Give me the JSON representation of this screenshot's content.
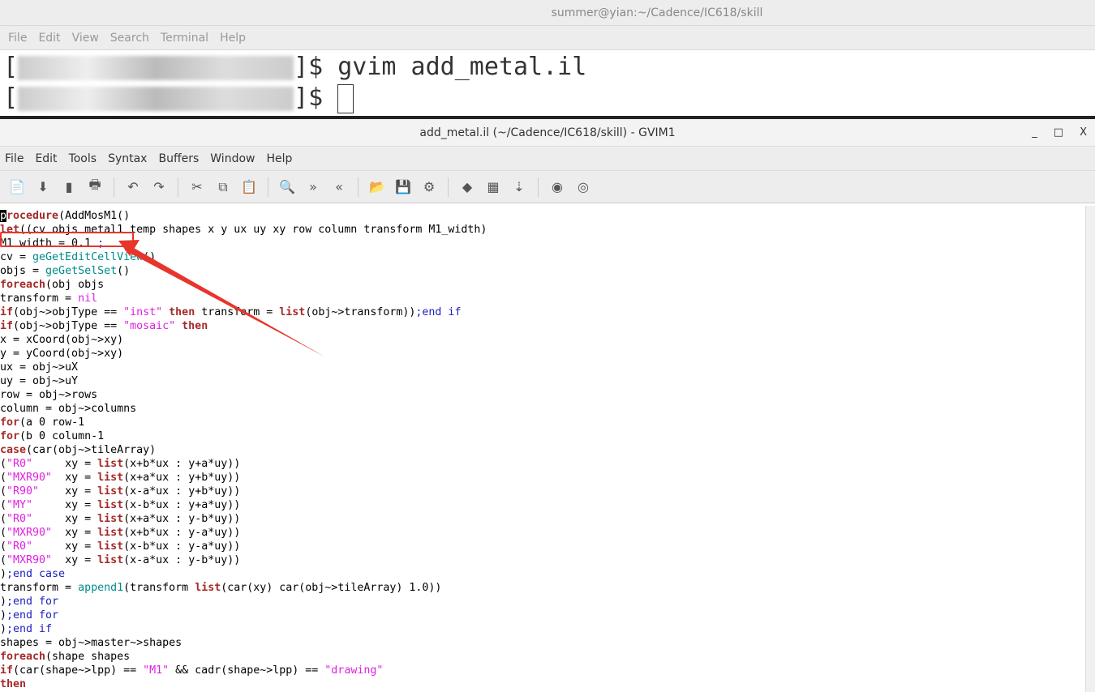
{
  "terminal": {
    "title": "summer@yian:~/Cadence/IC618/skill",
    "menu": [
      "File",
      "Edit",
      "View",
      "Search",
      "Terminal",
      "Help"
    ],
    "prompt_suffix": "]$ ",
    "command": "gvim add_metal.il",
    "prompt2_suffix": "]$ "
  },
  "gvim": {
    "title": "add_metal.il (~/Cadence/IC618/skill) - GVIM1",
    "controls": [
      "_",
      "□",
      "X"
    ],
    "menu": [
      "File",
      "Edit",
      "Tools",
      "Syntax",
      "Buffers",
      "Window",
      "Help"
    ],
    "toolbar": [
      {
        "name": "open",
        "g": "📄"
      },
      {
        "name": "save",
        "g": "⬇"
      },
      {
        "name": "save-all",
        "g": "▮"
      },
      {
        "name": "print",
        "g": "🖶"
      },
      "sep",
      {
        "name": "undo",
        "g": "↶"
      },
      {
        "name": "redo",
        "g": "↷"
      },
      "sep",
      {
        "name": "cut",
        "g": "✂"
      },
      {
        "name": "copy",
        "g": "⧉"
      },
      {
        "name": "paste",
        "g": "📋"
      },
      "sep",
      {
        "name": "find-replace",
        "g": "🔍"
      },
      {
        "name": "find-next",
        "g": "»"
      },
      {
        "name": "find-prev",
        "g": "«"
      },
      "sep",
      {
        "name": "load-session",
        "g": "📂"
      },
      {
        "name": "save-session",
        "g": "💾"
      },
      {
        "name": "run-script",
        "g": "⚙"
      },
      "sep",
      {
        "name": "make",
        "g": "◆"
      },
      {
        "name": "shell",
        "g": "▦"
      },
      {
        "name": "tags",
        "g": "⇣"
      },
      "sep",
      {
        "name": "help",
        "g": "◉"
      },
      {
        "name": "find-help",
        "g": "◎"
      }
    ]
  },
  "code": [
    [
      [
        "p",
        "cur"
      ],
      [
        "rocedure",
        "k"
      ],
      [
        "(AddMosM1()",
        ""
      ]
    ],
    [
      [
        "let",
        "k"
      ],
      [
        "((cv objs metal1 temp shapes x y ux uy xy row column transform M1_width)",
        ""
      ]
    ],
    [
      [
        "M1 width = 0.1 ",
        ""
      ],
      [
        ";",
        "b"
      ]
    ],
    [
      [
        "cv = ",
        ""
      ],
      [
        "geGetEditCellView",
        "f"
      ],
      [
        "()",
        ""
      ]
    ],
    [
      [
        "objs = ",
        ""
      ],
      [
        "geGetSelSet",
        "f"
      ],
      [
        "()",
        ""
      ]
    ],
    [
      [
        "foreach",
        "k"
      ],
      [
        "(obj objs",
        ""
      ]
    ],
    [
      [
        "transform = ",
        ""
      ],
      [
        "nil",
        "s"
      ]
    ],
    [
      [
        "if",
        "k"
      ],
      [
        "(obj~>objType == ",
        ""
      ],
      [
        "\"inst\"",
        "s"
      ],
      [
        " ",
        ""
      ],
      [
        "then",
        "k"
      ],
      [
        " transform = ",
        ""
      ],
      [
        "list",
        "k"
      ],
      [
        "(obj~>transform))",
        ""
      ],
      [
        ";end if",
        "b"
      ]
    ],
    [
      [
        "if",
        "k"
      ],
      [
        "(obj~>objType == ",
        ""
      ],
      [
        "\"mosaic\"",
        "s"
      ],
      [
        " ",
        ""
      ],
      [
        "then",
        "k"
      ]
    ],
    [
      [
        "x = xCoord(obj~>xy)",
        ""
      ]
    ],
    [
      [
        "y = yCoord(obj~>xy)",
        ""
      ]
    ],
    [
      [
        "ux = obj~>uX",
        ""
      ]
    ],
    [
      [
        "uy = obj~>uY",
        ""
      ]
    ],
    [
      [
        "row = obj~>rows",
        ""
      ]
    ],
    [
      [
        "column = obj~>columns",
        ""
      ]
    ],
    [
      [
        "for",
        "k"
      ],
      [
        "(a 0 row-1",
        ""
      ]
    ],
    [
      [
        "for",
        "k"
      ],
      [
        "(b 0 column-1",
        ""
      ]
    ],
    [
      [
        "case",
        "k"
      ],
      [
        "(car(obj~>tileArray)",
        ""
      ]
    ],
    [
      [
        "(",
        ""
      ],
      [
        "\"R0\"",
        "s"
      ],
      [
        "     xy = ",
        ""
      ],
      [
        "list",
        "k"
      ],
      [
        "(x+b*ux : y+a*uy))",
        ""
      ]
    ],
    [
      [
        "(",
        ""
      ],
      [
        "\"MXR90\"",
        "s"
      ],
      [
        "  xy = ",
        ""
      ],
      [
        "list",
        "k"
      ],
      [
        "(x+a*ux : y+b*uy))",
        ""
      ]
    ],
    [
      [
        "(",
        ""
      ],
      [
        "\"R90\"",
        "s"
      ],
      [
        "    xy = ",
        ""
      ],
      [
        "list",
        "k"
      ],
      [
        "(x-a*ux : y+b*uy))",
        ""
      ]
    ],
    [
      [
        "(",
        ""
      ],
      [
        "\"MY\"",
        "s"
      ],
      [
        "     xy = ",
        ""
      ],
      [
        "list",
        "k"
      ],
      [
        "(x-b*ux : y+a*uy))",
        ""
      ]
    ],
    [
      [
        "(",
        ""
      ],
      [
        "\"R0\"",
        "s"
      ],
      [
        "     xy = ",
        ""
      ],
      [
        "list",
        "k"
      ],
      [
        "(x+a*ux : y-b*uy))",
        ""
      ]
    ],
    [
      [
        "(",
        ""
      ],
      [
        "\"MXR90\"",
        "s"
      ],
      [
        "  xy = ",
        ""
      ],
      [
        "list",
        "k"
      ],
      [
        "(x+b*ux : y-a*uy))",
        ""
      ]
    ],
    [
      [
        "(",
        ""
      ],
      [
        "\"R0\"",
        "s"
      ],
      [
        "     xy = ",
        ""
      ],
      [
        "list",
        "k"
      ],
      [
        "(x-b*ux : y-a*uy))",
        ""
      ]
    ],
    [
      [
        "(",
        ""
      ],
      [
        "\"MXR90\"",
        "s"
      ],
      [
        "  xy = ",
        ""
      ],
      [
        "list",
        "k"
      ],
      [
        "(x-a*ux : y-b*uy))",
        ""
      ]
    ],
    [
      [
        ")",
        ""
      ],
      [
        ";end case",
        "b"
      ]
    ],
    [
      [
        "transform = ",
        ""
      ],
      [
        "append1",
        "f"
      ],
      [
        "(transform ",
        ""
      ],
      [
        "list",
        "k"
      ],
      [
        "(car(xy) car(obj~>tileArray) 1.0))",
        ""
      ]
    ],
    [
      [
        ")",
        ""
      ],
      [
        ";end for",
        "b"
      ]
    ],
    [
      [
        ")",
        ""
      ],
      [
        ";end for",
        "b"
      ]
    ],
    [
      [
        ")",
        ""
      ],
      [
        ";end if",
        "b"
      ]
    ],
    [
      [
        "shapes = obj~>master~>shapes",
        ""
      ]
    ],
    [
      [
        "foreach",
        "k"
      ],
      [
        "(shape shapes",
        ""
      ]
    ],
    [
      [
        "if",
        "k"
      ],
      [
        "(car(shape~>lpp) == ",
        ""
      ],
      [
        "\"M1\"",
        "s"
      ],
      [
        " && cadr(shape~>lpp) == ",
        ""
      ],
      [
        "\"drawing\"",
        "s"
      ]
    ],
    [
      [
        "then",
        "k"
      ]
    ]
  ],
  "colors": {
    "annotation": "#e8352b",
    "keyword": "#a52a2a",
    "string": "#e020e0",
    "function": "#008b8b",
    "comment_end": "#2020c0"
  }
}
